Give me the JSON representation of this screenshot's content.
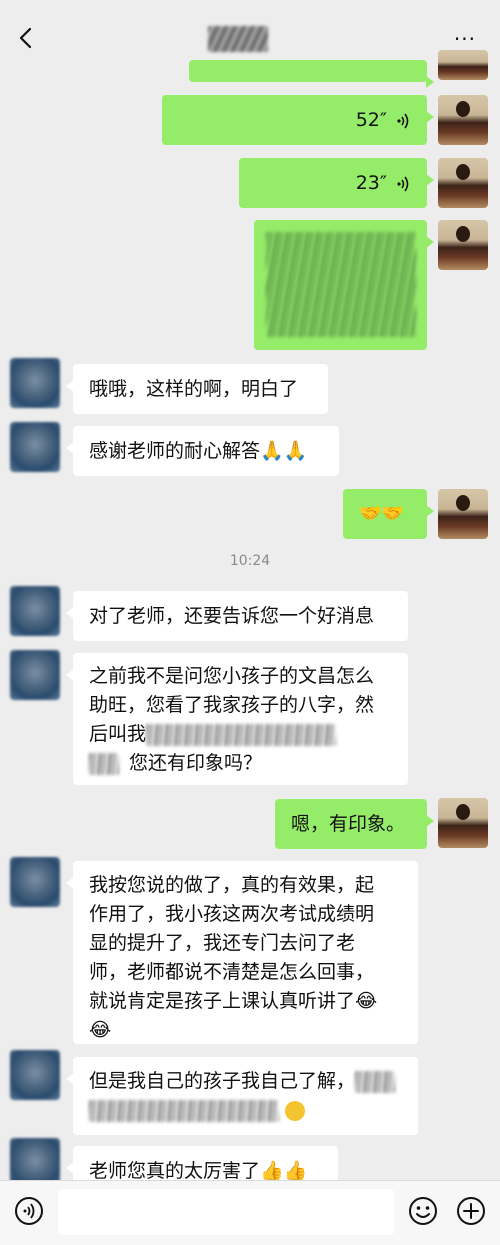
{
  "header": {
    "title": "",
    "back_icon": "chevron-left-icon",
    "more_label": "···"
  },
  "status_bar": {
    "left_text": "",
    "right_text": ""
  },
  "messages": [
    {
      "id": "m1",
      "sender": "me",
      "type": "text-partial"
    },
    {
      "id": "m2",
      "sender": "me",
      "type": "voice",
      "duration": "52″"
    },
    {
      "id": "m3",
      "sender": "me",
      "type": "voice",
      "duration": "23″"
    },
    {
      "id": "m4",
      "sender": "me",
      "type": "text-obscured"
    },
    {
      "id": "m5",
      "sender": "other",
      "type": "text",
      "text": "哦哦，这样的啊，明白了"
    },
    {
      "id": "m6",
      "sender": "other",
      "type": "text",
      "text": "感谢老师的耐心解答🙏🙏"
    },
    {
      "id": "m7",
      "sender": "me",
      "type": "text",
      "text": "🤝🤝"
    },
    {
      "id": "ts1",
      "type": "timestamp",
      "text": "10:24"
    },
    {
      "id": "m8",
      "sender": "other",
      "type": "text",
      "text": "对了老师，还要告诉您一个好消息"
    },
    {
      "id": "m9",
      "sender": "other",
      "type": "text",
      "line1": "之前我不是问您小孩子的文昌怎么",
      "line2": "助旺，您看了我家孩子的八字，然",
      "line3_prefix": "后叫我",
      "line4_suffix": "您还有印象吗？"
    },
    {
      "id": "m10",
      "sender": "me",
      "type": "text",
      "text": "嗯，有印象。"
    },
    {
      "id": "m11",
      "sender": "other",
      "type": "text",
      "line1": "我按您说的做了，真的有效果，起",
      "line2": "作用了，我小孩这两次考试成绩明",
      "line3": "显的提升了，我还专门去问了老",
      "line4": "师，老师都说不清楚是怎么回事，",
      "line5": "就说肯定是孩子上课认真听讲了😂",
      "line6": "😂"
    },
    {
      "id": "m12",
      "sender": "other",
      "type": "text",
      "line1_prefix": "但是我自己的孩子我自己了解，"
    },
    {
      "id": "m13",
      "sender": "other",
      "type": "text",
      "text": "老师您真的太厉害了👍👍"
    }
  ],
  "input_bar": {
    "voice_icon": "voice-input-icon",
    "emoji_icon": "emoji-icon",
    "plus_icon": "plus-icon",
    "placeholder": ""
  },
  "colors": {
    "background": "#ededed",
    "bubble_me": "#95ec69",
    "bubble_other": "#ffffff",
    "timestamp": "#8a8a8a"
  }
}
